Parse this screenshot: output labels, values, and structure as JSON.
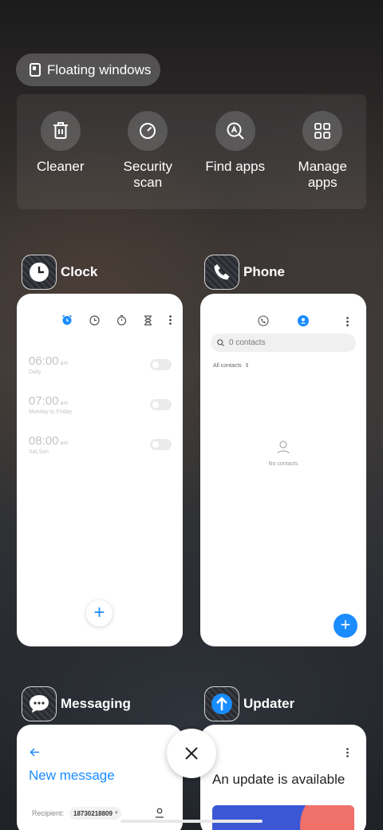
{
  "floating_windows": {
    "label": "Floating windows",
    "icon": "floating-window-icon"
  },
  "tools": [
    {
      "label": "Cleaner",
      "icon": "trash-icon"
    },
    {
      "label": "Security\nscan",
      "icon": "security-scan-icon"
    },
    {
      "label": "Find apps",
      "icon": "find-apps-icon"
    },
    {
      "label": "Manage\napps",
      "icon": "grid-icon"
    }
  ],
  "apps": {
    "clock": {
      "name": "Clock",
      "alarms": [
        {
          "time": "06:00",
          "ampm": "am",
          "repeat": "Daily",
          "enabled": false
        },
        {
          "time": "07:00",
          "ampm": "am",
          "repeat": "Monday to Friday",
          "enabled": false
        },
        {
          "time": "08:00",
          "ampm": "am",
          "repeat": "Sat,Sun",
          "enabled": false
        }
      ],
      "fab": "+"
    },
    "phone": {
      "name": "Phone",
      "search_placeholder": "0 contacts",
      "filter": "All contacts",
      "empty": "No contacts",
      "fab": "+"
    },
    "messaging": {
      "name": "Messaging",
      "title": "New message",
      "recipient_label": "Recipient:",
      "recipient_chip": "18730218809"
    },
    "updater": {
      "name": "Updater",
      "title": "An update is available"
    }
  },
  "colors": {
    "accent": "#1a8cff",
    "update_banner_left": "#3b57d6",
    "update_banner_right": "#f0706a",
    "messaging_accent": "#1a8cff"
  }
}
